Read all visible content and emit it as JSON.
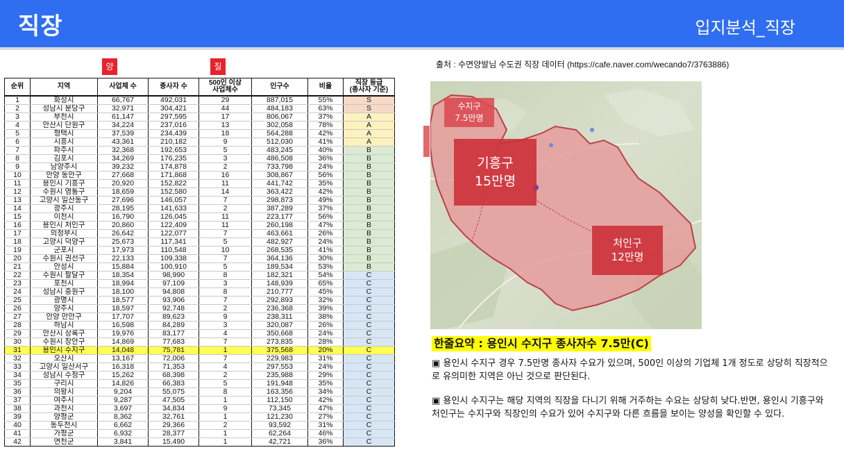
{
  "header": {
    "title": "직장",
    "subtitle": "입지분석_직장"
  },
  "tags": {
    "quantity": "양",
    "quality": "질"
  },
  "source": "출처 : 수면양발님 수도권 직장 데이터 (https://cafe.naver.com/wecando7/3763886)",
  "table": {
    "headers": {
      "rank": "순위",
      "region": "지역",
      "companies": "사업체 수",
      "workers": "종사자 수",
      "large": "500인 이상\n사업체수",
      "population": "인구수",
      "ratio": "비율",
      "grade": "직장 등급\n(종사자 기준)"
    },
    "rows": [
      [
        "1",
        "화성시",
        "66,767",
        "492,031",
        "29",
        "887,015",
        "55%",
        "S"
      ],
      [
        "2",
        "성남시 분당구",
        "32,971",
        "304,421",
        "44",
        "484,183",
        "63%",
        "S"
      ],
      [
        "3",
        "부천시",
        "61,147",
        "297,595",
        "17",
        "806,067",
        "37%",
        "A"
      ],
      [
        "4",
        "안산시 단원구",
        "34,224",
        "237,016",
        "13",
        "302,058",
        "78%",
        "A"
      ],
      [
        "5",
        "평택시",
        "37,539",
        "234,439",
        "18",
        "564,288",
        "42%",
        "A"
      ],
      [
        "6",
        "시흥시",
        "43,361",
        "210,182",
        "9",
        "512,030",
        "41%",
        "A"
      ],
      [
        "7",
        "파주시",
        "32,368",
        "192,653",
        "5",
        "483,245",
        "40%",
        "B"
      ],
      [
        "8",
        "김포시",
        "34,269",
        "176,235",
        "3",
        "486,508",
        "36%",
        "B"
      ],
      [
        "9",
        "남양주시",
        "39,232",
        "174,878",
        "2",
        "733,798",
        "24%",
        "B"
      ],
      [
        "10",
        "안양 동안구",
        "27,668",
        "171,868",
        "16",
        "308,867",
        "56%",
        "B"
      ],
      [
        "11",
        "용인시 기흥구",
        "20,920",
        "152,822",
        "11",
        "441,742",
        "35%",
        "B"
      ],
      [
        "12",
        "수원시 영통구",
        "18,659",
        "152,580",
        "14",
        "363,422",
        "42%",
        "B"
      ],
      [
        "13",
        "고양시 일산동구",
        "27,696",
        "146,057",
        "7",
        "298,873",
        "49%",
        "B"
      ],
      [
        "14",
        "광주시",
        "28,195",
        "141,633",
        "2",
        "387,289",
        "37%",
        "B"
      ],
      [
        "15",
        "이천시",
        "16,790",
        "126,045",
        "11",
        "223,177",
        "56%",
        "B"
      ],
      [
        "16",
        "용인시 처인구",
        "20,860",
        "122,409",
        "11",
        "260,198",
        "47%",
        "B"
      ],
      [
        "17",
        "의정부시",
        "26,642",
        "122,077",
        "7",
        "463,661",
        "26%",
        "B"
      ],
      [
        "18",
        "고양시 덕양구",
        "25,673",
        "117,341",
        "5",
        "482,927",
        "24%",
        "B"
      ],
      [
        "19",
        "군포시",
        "17,973",
        "110,548",
        "10",
        "268,535",
        "41%",
        "B"
      ],
      [
        "20",
        "수원시 권선구",
        "22,133",
        "109,338",
        "7",
        "364,136",
        "30%",
        "B"
      ],
      [
        "21",
        "안성시",
        "15,884",
        "100,910",
        "5",
        "189,534",
        "53%",
        "B"
      ],
      [
        "22",
        "수원시 팔달구",
        "18,354",
        "98,990",
        "8",
        "182,321",
        "54%",
        "C"
      ],
      [
        "23",
        "포천시",
        "18,994",
        "97,109",
        "3",
        "148,939",
        "65%",
        "C"
      ],
      [
        "24",
        "성남시 중원구",
        "18,100",
        "94,808",
        "8",
        "210,777",
        "45%",
        "C"
      ],
      [
        "25",
        "광명시",
        "18,577",
        "93,906",
        "7",
        "292,893",
        "32%",
        "C"
      ],
      [
        "26",
        "양주시",
        "18,597",
        "92,748",
        "2",
        "236,368",
        "39%",
        "C"
      ],
      [
        "27",
        "안양 만안구",
        "17,707",
        "89,623",
        "9",
        "238,311",
        "38%",
        "C"
      ],
      [
        "28",
        "하남시",
        "16,598",
        "84,289",
        "3",
        "320,087",
        "26%",
        "C"
      ],
      [
        "29",
        "안산시 상록구",
        "19,976",
        "83,177",
        "4",
        "350,668",
        "24%",
        "C"
      ],
      [
        "30",
        "수원시 장안구",
        "14,869",
        "77,683",
        "7",
        "273,835",
        "28%",
        "C"
      ],
      [
        "31",
        "용인시 수지구",
        "14,048",
        "75,781",
        "1",
        "375,568",
        "20%",
        "C"
      ],
      [
        "32",
        "오산시",
        "13,167",
        "72,006",
        "7",
        "229,983",
        "31%",
        "C"
      ],
      [
        "33",
        "고양시 일산서구",
        "16,318",
        "71,353",
        "4",
        "297,553",
        "24%",
        "C"
      ],
      [
        "34",
        "성남시 수정구",
        "15,262",
        "68,398",
        "2",
        "235,988",
        "29%",
        "C"
      ],
      [
        "35",
        "구리시",
        "14,826",
        "66,383",
        "5",
        "191,948",
        "35%",
        "C"
      ],
      [
        "36",
        "의왕시",
        "9,204",
        "55,075",
        "8",
        "163,356",
        "34%",
        "C"
      ],
      [
        "37",
        "여주시",
        "9,287",
        "47,505",
        "1",
        "112,150",
        "42%",
        "C"
      ],
      [
        "38",
        "과천시",
        "3,697",
        "34,834",
        "9",
        "73,345",
        "47%",
        "C"
      ],
      [
        "39",
        "양평군",
        "8,362",
        "32,761",
        "1",
        "121,230",
        "27%",
        "C"
      ],
      [
        "40",
        "동두천시",
        "6,662",
        "29,366",
        "2",
        "93,592",
        "31%",
        "C"
      ],
      [
        "41",
        "가평군",
        "6,932",
        "28,377",
        "1",
        "62,264",
        "46%",
        "C"
      ],
      [
        "42",
        "연천군",
        "3,841",
        "15,490",
        "1",
        "42,721",
        "36%",
        "C"
      ]
    ],
    "highlight_rank": "31"
  },
  "map": {
    "labels": {
      "suji": {
        "name": "수지구",
        "workers": "7.5만명"
      },
      "giheung": {
        "name": "기흥구",
        "workers": "15만명"
      },
      "cheoin": {
        "name": "처인구",
        "workers": "12만명"
      }
    },
    "colors": {
      "region_fill": "#e8a0a0",
      "label_bg": "#cd2d37"
    }
  },
  "summary": {
    "headline": "한줄요약 : 용인시 수지구 종사자수 7.5만(C)",
    "paragraph1": "▣ 용인시 수지구 경우 7.5만명 종사자 수요가 있으며, 500인 이상의 기업체 1개 정도로 상당히 직장적으로 유의미한 지역은 아닌 것으로 판단된다.",
    "paragraph2": "▣ 용인시 수지구는 해당 지역의 직장을 다니기 위해 거주하는 수요는 상당히 낮다.반면, 용인시 기흥구와 처인구는 수지구와 직장인의 수요가 있어 수지구와 다른 흐름을 보이는 양성을 확인할 수 있다."
  }
}
